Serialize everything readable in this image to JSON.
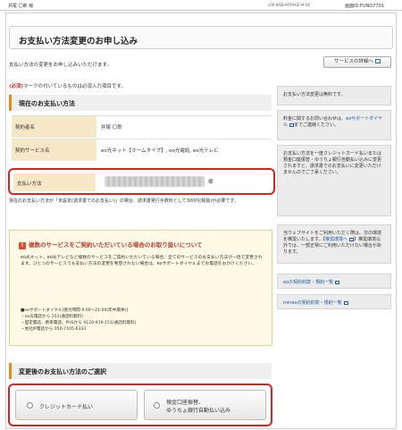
{
  "topbar": {
    "user": "井尾 〇郎 様",
    "meta": "c06-WEB-MYPAGE-M-06",
    "screen_id": "画面ID:FUNO7701"
  },
  "page": {
    "title": "お支払い方法変更のお申し込み",
    "intro": "支払い方法の変更をお申し込みいただけます。",
    "details_button": "サービスの詳細へ",
    "required_badge": "(必須)",
    "required_note": "マークの付いているものは必須入力項目です。"
  },
  "current_section": {
    "heading": "現在のお支払い方法",
    "rows": [
      {
        "label": "契約者名",
        "value": "井尾 〇郎"
      },
      {
        "label": "契約サービス名",
        "value": "eo光ネット【ホームタイプ】, eo光電話, eo光テレビ"
      }
    ],
    "payment_label": "支払い方法",
    "payment_suffix": "様",
    "payment_note": "現在のお支払い方法が「未設定(請求書でのお支払い)」の場合、請求書発行手数料として300円(税抜)が必要です。"
  },
  "notice": {
    "icon": "!",
    "heading": "複数のサービスをご契約いただいている場合のお取り扱いについて",
    "body": "eo光ネット、eo光テレビなど複数のサービスをご契約いただいている場合、全てのサービスのお支払い方法が一括で変更されます。ひとつのサービスでも支払い方法の変更を希望されない場合は、eoサポートダイヤルまでお電話をおかけください。",
    "contact": [
      "■eoサポートダイヤル[受付時間 9:00～21:00(年中無休)]",
      "・eo光電話から 151(通話料無料)",
      "・固定電話、携帯電話、PHSから 0120-919-151(通話料無料)",
      "・他社IP電話から 050-7105-6333"
    ]
  },
  "change_section": {
    "heading": "変更後のお支払い方法のご選択",
    "options": [
      {
        "label": "クレジットカード払い"
      },
      {
        "label_line1": "預金口座振替、",
        "label_line2": "ゆうちょ銀行自動払い込み"
      }
    ]
  },
  "sidebar": {
    "box1": "お支払い方法変更は無料です。",
    "box2_pre": "料金に関するお問い合わせは、",
    "box2_link": "eoサポートダイヤル",
    "box2_post": "までご連絡ください。",
    "box3": "お支払い方法を一度クレジットカード払いまたは預金口座振替・ゆうちょ銀行自動払い込みに変更されますと、請求書でのお支払いに変更いただけませんのでご了承ください。",
    "box4_pre": "当ウェブサイトをご利用いただく際は、次の環境を推奨いたします。",
    "box4_link": "推奨環境へ",
    "box4_post": "推奨環境以外では、一部正常にご利用いただけない場合があります。",
    "link1": "eoの契約約款・規約一覧",
    "link2": "mineoの契約約款・規約一覧"
  }
}
